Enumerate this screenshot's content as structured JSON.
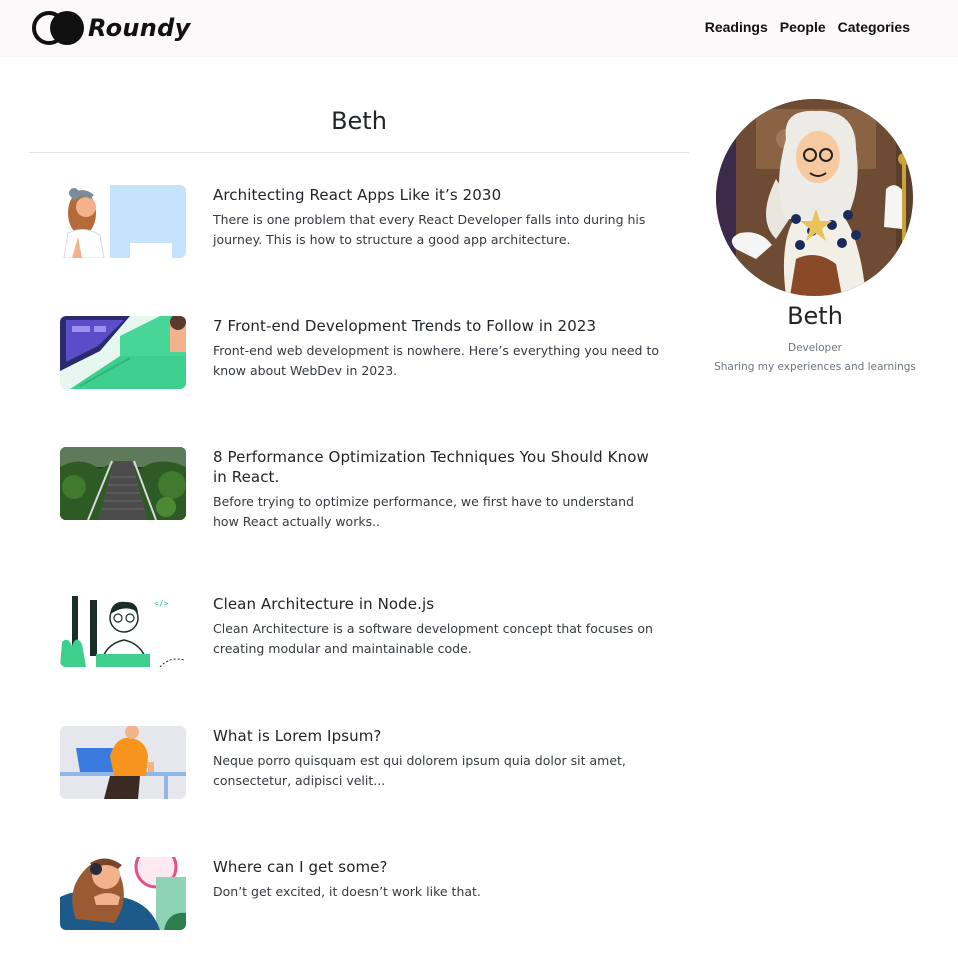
{
  "brand": {
    "name": "Roundy"
  },
  "nav": {
    "items": [
      "Readings",
      "People",
      "Categories"
    ]
  },
  "author": {
    "name": "Beth",
    "role": "Developer",
    "bio": "Sharing my experiences and learnings"
  },
  "posts": [
    {
      "title": "Architecting React Apps Like it’s 2030",
      "description": "There is one problem that every React Developer falls into during his journey. This is how to structure a good app architecture."
    },
    {
      "title": "7 Front-end Development Trends to Follow in 2023",
      "description": "Front-end web development is nowhere. Here’s everything you need to know about WebDev in 2023."
    },
    {
      "title": "8 Performance Optimization Techniques You Should Know in React.",
      "description": "Before trying to optimize performance, we first have to understand how React actually works.."
    },
    {
      "title": "Clean Architecture in Node.js",
      "description": "Clean Architecture is a software development concept that focuses on creating modular and maintainable code."
    },
    {
      "title": "What is Lorem Ipsum?",
      "description": "Neque porro quisquam est qui dolorem ipsum quia dolor sit amet, consectetur, adipisci velit..."
    },
    {
      "title": "Where can I get some?",
      "description": "Don’t get excited, it doesn’t work like that."
    }
  ],
  "thumb_code_glyph": "</>",
  "colors": {
    "header_bg": "#fbf9f9",
    "text": "#212529",
    "muted": "#6c757d",
    "accent_green": "#3ecf8e"
  }
}
